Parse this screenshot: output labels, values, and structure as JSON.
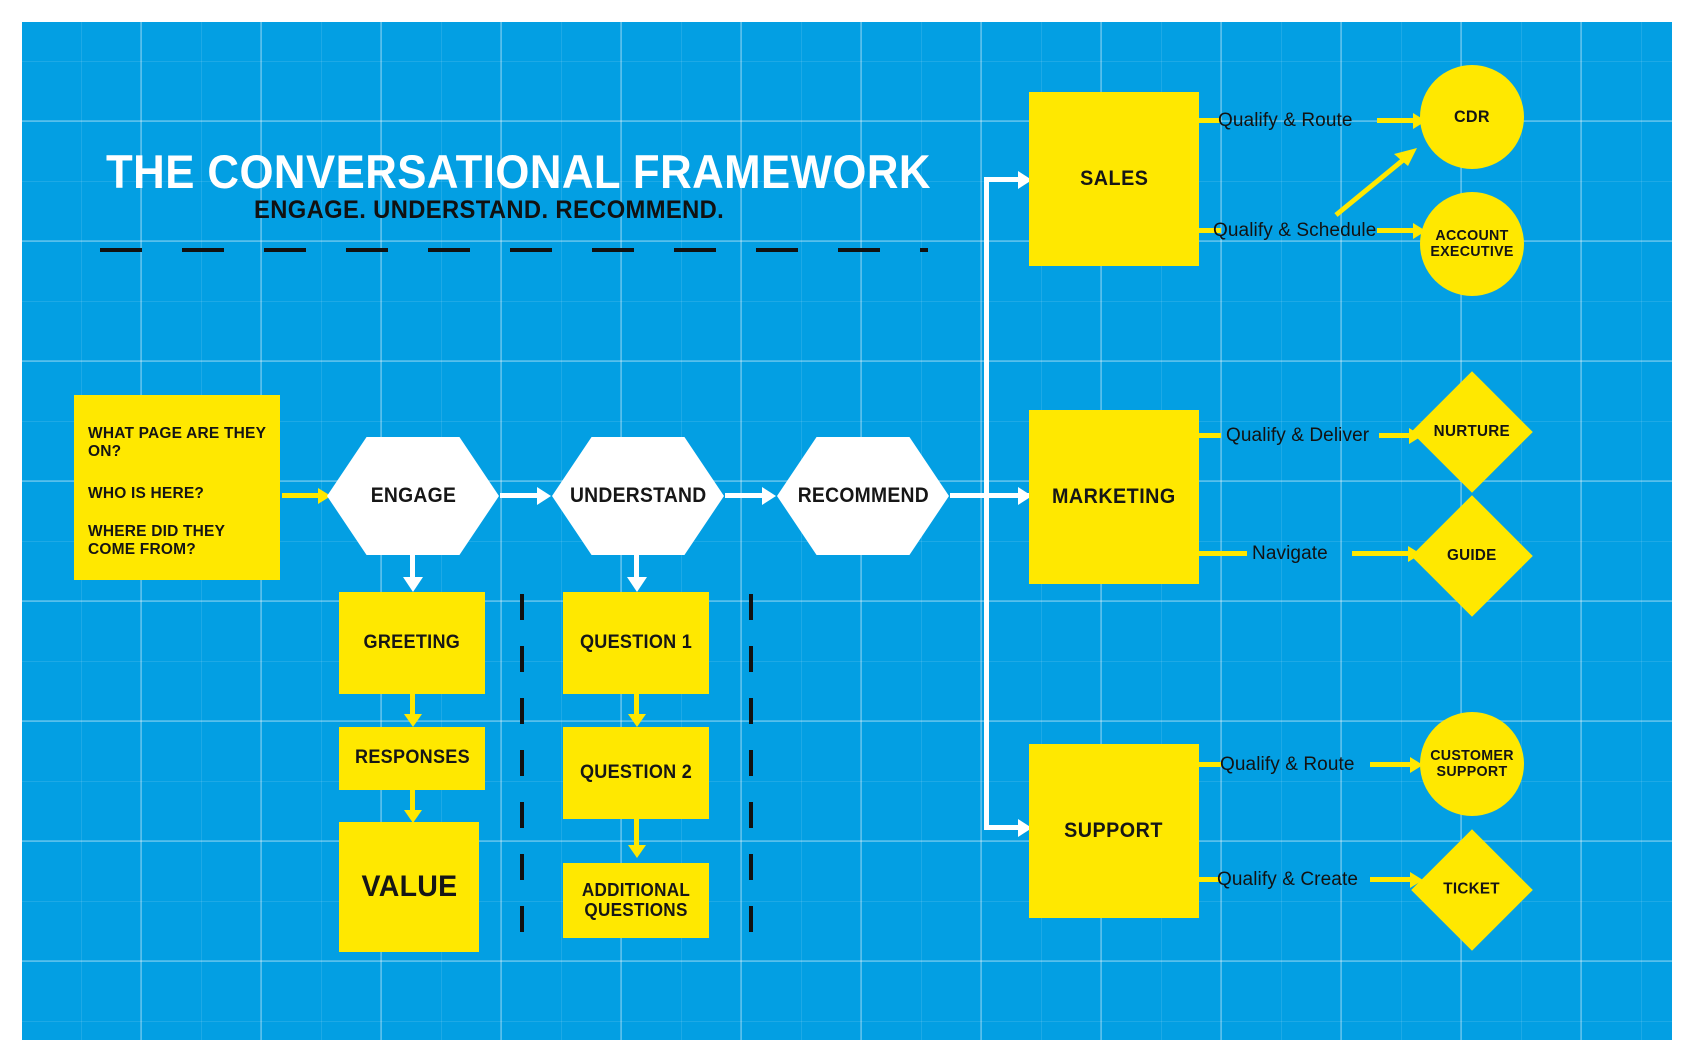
{
  "header": {
    "title": "THE CONVERSATIONAL FRAMEWORK",
    "subtitle": "ENGAGE. UNDERSTAND. RECOMMEND."
  },
  "colors": {
    "background_blue": "#039fe3",
    "accent_yellow": "#ffe800",
    "white": "#ffffff",
    "text_dark": "#141414"
  },
  "intake": {
    "questions": [
      "WHAT PAGE ARE THEY ON?",
      "WHO IS HERE?",
      "WHERE DID THEY COME FROM?"
    ]
  },
  "stages": [
    {
      "label": "ENGAGE"
    },
    {
      "label": "UNDERSTAND"
    },
    {
      "label": "RECOMMEND"
    }
  ],
  "engage_column": [
    {
      "label": "GREETING"
    },
    {
      "label": "RESPONSES"
    },
    {
      "label": "VALUE"
    }
  ],
  "understand_column": [
    {
      "label": "QUESTION 1"
    },
    {
      "label": "QUESTION 2"
    },
    {
      "label": "ADDITIONAL QUESTIONS"
    }
  ],
  "channels": [
    {
      "label": "SALES"
    },
    {
      "label": "MARKETING"
    },
    {
      "label": "SUPPORT"
    }
  ],
  "edges": [
    {
      "label": "Qualify & Route",
      "from": "SALES",
      "to": "CDR"
    },
    {
      "label": "Qualify & Schedule",
      "from": "SALES",
      "to": "ACCOUNT EXECUTIVE"
    },
    {
      "label": "Qualify & Deliver",
      "from": "MARKETING",
      "to": "NURTURE"
    },
    {
      "label": "Navigate",
      "from": "MARKETING",
      "to": "GUIDE"
    },
    {
      "label": "Qualify & Route",
      "from": "SUPPORT",
      "to": "CUSTOMER SUPPORT"
    },
    {
      "label": "Qualify & Create",
      "from": "SUPPORT",
      "to": "TICKET"
    }
  ],
  "outcomes": [
    {
      "label": "CDR",
      "shape": "circle"
    },
    {
      "label": "ACCOUNT EXECUTIVE",
      "shape": "circle"
    },
    {
      "label": "NURTURE",
      "shape": "diamond"
    },
    {
      "label": "GUIDE",
      "shape": "diamond"
    },
    {
      "label": "CUSTOMER SUPPORT",
      "shape": "circle"
    },
    {
      "label": "TICKET",
      "shape": "diamond"
    }
  ]
}
